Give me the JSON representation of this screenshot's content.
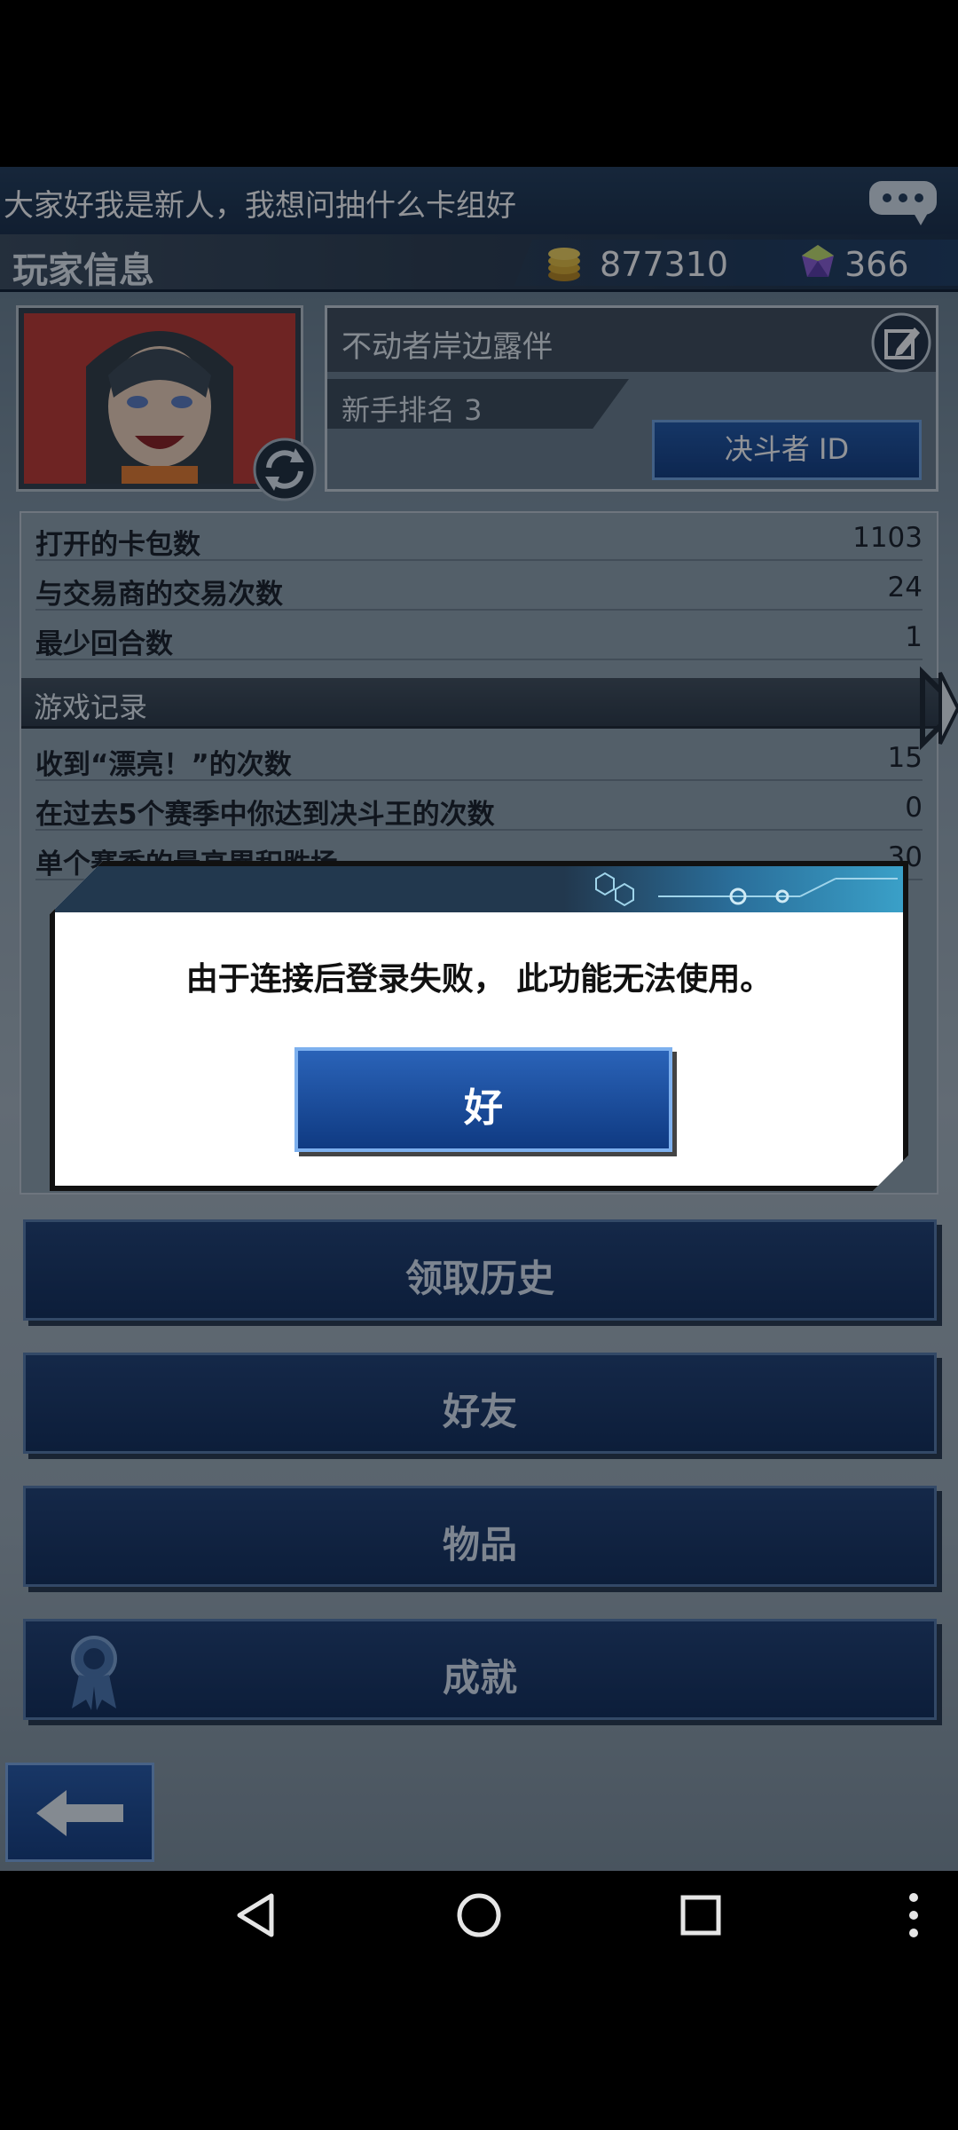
{
  "chat": {
    "message": "大家好我是新人，我想问抽什么卡组好",
    "icon": "chat-bubble-icon"
  },
  "header": {
    "title": "玩家信息",
    "gold": "877310",
    "gems": "366",
    "colors": {
      "accent": "#1e56a6",
      "bar": "#162b45"
    }
  },
  "profile": {
    "name": "不动者岸边露伴",
    "rank": "新手排名 3",
    "duelist_id_label": "决斗者 ID"
  },
  "stats": {
    "rows": [
      {
        "label": "打开的卡包数",
        "value": "1103"
      },
      {
        "label": "与交易商的交易次数",
        "value": "24"
      },
      {
        "label": "最少回合数",
        "value": "1"
      }
    ],
    "section_title": "游戏记录",
    "records": [
      {
        "label": "收到“漂亮！”的次数",
        "value": "15"
      },
      {
        "label": "在过去5个赛季中你达到决斗王的次数",
        "value": "0"
      },
      {
        "label": "单个赛季的最高累积胜场",
        "value": "30"
      }
    ]
  },
  "menu": {
    "items": [
      "领取历史",
      "好友",
      "物品",
      "成就"
    ]
  },
  "dialog": {
    "message": "由于连接后登录失败， 此功能无法使用。",
    "ok_label": "好"
  }
}
